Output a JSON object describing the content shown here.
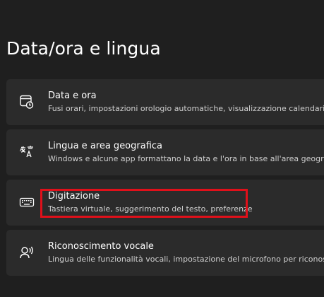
{
  "page": {
    "title": "Data/ora e lingua"
  },
  "items": [
    {
      "icon": "calendar-clock-icon",
      "label": "Data e ora",
      "description": "Fusi orari, impostazioni orologio automatiche, visualizzazione calendario"
    },
    {
      "icon": "language-icon",
      "label": "Lingua e area geografica",
      "description": "Windows e alcune app formattano la data e l'ora in base all'area geografica"
    },
    {
      "icon": "keyboard-icon",
      "label": "Digitazione",
      "description": "Tastiera virtuale, suggerimento del testo, preferenze"
    },
    {
      "icon": "speech-recognition-icon",
      "label": "Riconoscimento vocale",
      "description": "Lingua delle funzionalità vocali, impostazione del microfono per riconoscimento vocale"
    }
  ],
  "highlight_color": "#e0101a"
}
